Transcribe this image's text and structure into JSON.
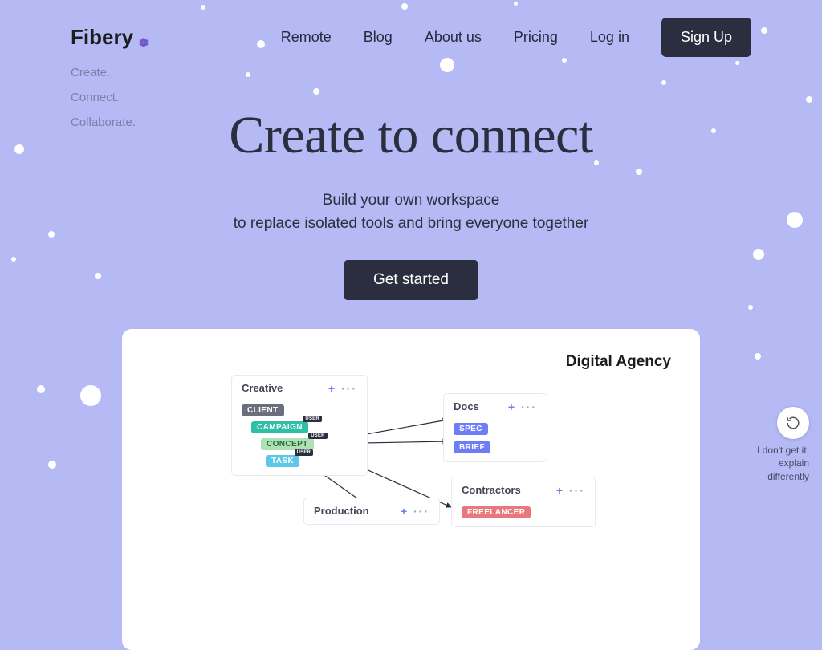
{
  "brand": {
    "name": "Fibery"
  },
  "nav": {
    "items": [
      "Remote",
      "Blog",
      "About us",
      "Pricing",
      "Log in"
    ],
    "signup": "Sign Up"
  },
  "side_words": [
    "Create.",
    "Connect.",
    "Collaborate."
  ],
  "hero": {
    "title": "Create to connect",
    "subtitle_line1": "Build your own workspace",
    "subtitle_line2": "to replace isolated tools and bring everyone together",
    "cta": "Get started"
  },
  "diagram": {
    "title": "Digital Agency",
    "groups": {
      "creative": {
        "label": "Creative",
        "chips": [
          {
            "text": "CLIENT",
            "color": "#6a6e7d",
            "sup": null,
            "indent": 0
          },
          {
            "text": "CAMPAIGN",
            "color": "#2fbfa5",
            "sup": "USER",
            "indent": 1
          },
          {
            "text": "CONCEPT",
            "color": "#aee2b5",
            "sup": "USER",
            "indent": 2,
            "textColor": "#2f6a44"
          },
          {
            "text": "TASK",
            "color": "#5cc7e6",
            "sup": "USER",
            "indent": 3
          }
        ]
      },
      "docs": {
        "label": "Docs",
        "chips": [
          {
            "text": "SPEC",
            "color": "#6d7df6"
          },
          {
            "text": "BRIEF",
            "color": "#6d7df6"
          }
        ]
      },
      "contractors": {
        "label": "Contractors",
        "chips": [
          {
            "text": "FREELANCER",
            "color": "#e9777e"
          }
        ]
      },
      "production": {
        "label": "Production"
      }
    },
    "actions": {
      "plus": "+",
      "more": "···"
    }
  },
  "feedback": {
    "line1": "I don't get it,",
    "line2": "explain",
    "line3": "differently"
  },
  "colors": {
    "bg": "#b5b9f4",
    "dark": "#2a2e3f"
  }
}
